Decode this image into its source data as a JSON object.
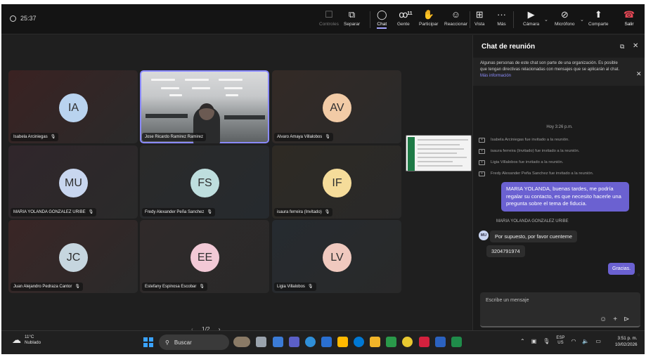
{
  "window": {
    "timer": "25:37"
  },
  "toolbar": {
    "controles": "Controles",
    "separar": "Separar",
    "chat": "Chat",
    "gente": "Gente",
    "gente_count": "11",
    "participar": "Participar",
    "reaccionar": "Reaccionar",
    "vista": "Vista",
    "mas": "Más",
    "camara": "Cámara",
    "microfono": "Micrófono",
    "compartir": "Comparte",
    "salir": "Salir"
  },
  "participants": [
    {
      "initials": "IA",
      "name": "Isabela Arciniegas",
      "color": "#b9d3ef"
    },
    {
      "initials": "",
      "name": "Jose Ricardo Ramirez Ramirez",
      "color": ""
    },
    {
      "initials": "AV",
      "name": "Alvaro Amaya Villalobos",
      "color": "#f2cba6"
    },
    {
      "initials": "MU",
      "name": "MARIA YOLANDA GONZALEZ URIBE",
      "color": "#c8d6ef"
    },
    {
      "initials": "FS",
      "name": "Fredy Alexander Peña Sanchez",
      "color": "#bedede"
    },
    {
      "initials": "IF",
      "name": "isaura ferreira (Invitado)",
      "color": "#f5dc9a"
    },
    {
      "initials": "JC",
      "name": "Juan Alejandro Pedraza Cantor",
      "color": "#c6d6df"
    },
    {
      "initials": "EE",
      "name": "Estefany Espinosa Escobar",
      "color": "#f2c9d6"
    },
    {
      "initials": "LV",
      "name": "Ligia Villalobos",
      "color": "#f0c9bf"
    }
  ],
  "pager": {
    "prev": "‹",
    "label": "1/2",
    "next": "›"
  },
  "chat": {
    "title": "Chat de reunión",
    "notice": "Algunas personas de este chat son parte de una organización. Es posible que tengan directivas relacionadas con mensajes que se aplicarán al chat.",
    "notice_link": "Más información",
    "time": "Hoy 3:26 p.m.",
    "system": [
      "Isabela Arciniegas fue invitado a la reunión.",
      "isaura ferreira (Invitado) fue invitado a la reunión.",
      "Ligia Villalobos fue invitado a la reunión.",
      "Fredy Alexander Peña Sanchez fue invitado a la reunión."
    ],
    "my_message": "MARIA YOLANDA, buenas tardes, me podría regalar su contacto, es que necesito hacerle una pregunta sobre el tema de fiducia.",
    "sender": "MARIA YOLANDA GONZALEZ URIBE",
    "sender_initials": "MU",
    "reply1": "Por supuesto, por favor cuenteme",
    "reply2": "3204791974",
    "my_message2": "Gracias.",
    "compose_placeholder": "Escribe un mensaje"
  },
  "taskbar": {
    "temp": "11°C",
    "weather": "Nublado",
    "search": "Buscar",
    "lang1": "ESP",
    "lang2": "US",
    "time": "3:51 p. m.",
    "date": "10/02/2026"
  }
}
